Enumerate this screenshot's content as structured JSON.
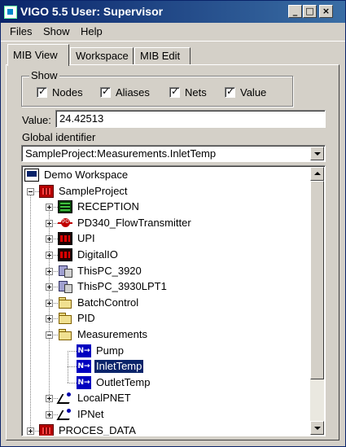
{
  "window": {
    "title": "VIGO 5.5  User: Supervisor"
  },
  "menu": {
    "files": "Files",
    "show": "Show",
    "help": "Help"
  },
  "tabs": [
    "MIB View",
    "Workspace",
    "MIB Edit"
  ],
  "show_group": {
    "label": "Show",
    "options": [
      {
        "label": "Nodes",
        "checked": true
      },
      {
        "label": "Aliases",
        "checked": true
      },
      {
        "label": "Nets",
        "checked": true
      },
      {
        "label": "Value",
        "checked": true
      }
    ]
  },
  "value_field": {
    "label": "Value:",
    "value": "24.42513"
  },
  "global_identifier": {
    "label": "Global identifier",
    "value": "SampleProject:Measurements.InletTemp"
  },
  "tree": {
    "items": [
      {
        "label": "Demo Workspace",
        "icon": "computer-icon"
      },
      {
        "label": "SampleProject",
        "icon": "project-icon"
      },
      {
        "label": "RECEPTION",
        "icon": "reception-icon"
      },
      {
        "label": "PD340_FlowTransmitter",
        "icon": "transmitter-icon"
      },
      {
        "label": "UPI",
        "icon": "chip-icon"
      },
      {
        "label": "DigitalIO",
        "icon": "chip-icon"
      },
      {
        "label": "ThisPC_3920",
        "icon": "pc-icon"
      },
      {
        "label": "ThisPC_3930LPT1",
        "icon": "pc-icon"
      },
      {
        "label": "BatchControl",
        "icon": "folder-icon"
      },
      {
        "label": "PID",
        "icon": "folder-icon"
      },
      {
        "label": "Measurements",
        "icon": "open-folder-icon"
      },
      {
        "label": "Pump",
        "icon": "node-icon"
      },
      {
        "label": "InletTemp",
        "icon": "node-icon"
      },
      {
        "label": "OutletTemp",
        "icon": "node-icon"
      },
      {
        "label": "LocalPNET",
        "icon": "net-icon"
      },
      {
        "label": "IPNet",
        "icon": "net-icon"
      },
      {
        "label": "PROCES_DATA",
        "icon": "project-icon"
      }
    ],
    "selected": "InletTemp",
    "node_icon_text": "N→"
  }
}
